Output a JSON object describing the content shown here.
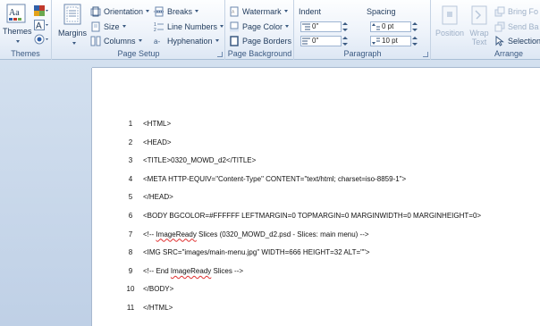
{
  "ribbon": {
    "groups": {
      "themes": {
        "label": "Themes",
        "themes_button": "Themes"
      },
      "page_setup": {
        "label": "Page Setup",
        "margins": "Margins",
        "orientation": "Orientation",
        "size": "Size",
        "columns": "Columns",
        "breaks": "Breaks",
        "line_numbers": "Line Numbers",
        "hyphenation": "Hyphenation"
      },
      "page_background": {
        "label": "Page Background",
        "watermark": "Watermark",
        "page_color": "Page Color",
        "page_borders": "Page Borders"
      },
      "paragraph": {
        "label": "Paragraph",
        "indent_title": "Indent",
        "spacing_title": "Spacing",
        "indent_left": "0\"",
        "indent_right": "0\"",
        "spacing_before": "0 pt",
        "spacing_after": "10 pt"
      },
      "arrange": {
        "label": "Arrange",
        "position": "Position",
        "wrap_text": "Wrap\nText",
        "bring_forward": "Bring Fo",
        "send_backward": "Send Ba",
        "selection": "Selection"
      }
    }
  },
  "document": {
    "lines": [
      {
        "num": "1",
        "text": "<HTML>"
      },
      {
        "num": "2",
        "text": "<HEAD>"
      },
      {
        "num": "3",
        "text": "<TITLE>0320_MOWD_d2</TITLE>"
      },
      {
        "num": "4",
        "text": "<META HTTP-EQUIV=\"Content-Type\" CONTENT=\"text/html; charset=iso-8859-1\">"
      },
      {
        "num": "5",
        "text": "</HEAD>"
      },
      {
        "num": "6",
        "text": "<BODY BGCOLOR=#FFFFFF LEFTMARGIN=0 TOPMARGIN=0 MARGINWIDTH=0 MARGINHEIGHT=0>"
      },
      {
        "num": "7",
        "pre": "<!-- ",
        "err": "ImageReady",
        "post": " Slices (0320_MOWD_d2.psd - Slices: main menu) -->"
      },
      {
        "num": "8",
        "text": "<IMG SRC=\"images/main-menu.jpg\" WIDTH=666 HEIGHT=32 ALT=\"\">"
      },
      {
        "num": "9",
        "pre": "<!-- End ",
        "err": "ImageReady",
        "post": " Slices -->"
      },
      {
        "num": "10",
        "text": "</BODY>"
      },
      {
        "num": "11",
        "text": "</HTML>"
      }
    ]
  },
  "colors": {
    "ribbon_text": "#1e395b",
    "workspace_bg": "#c8d8ec",
    "spell_error": "#e03030"
  }
}
